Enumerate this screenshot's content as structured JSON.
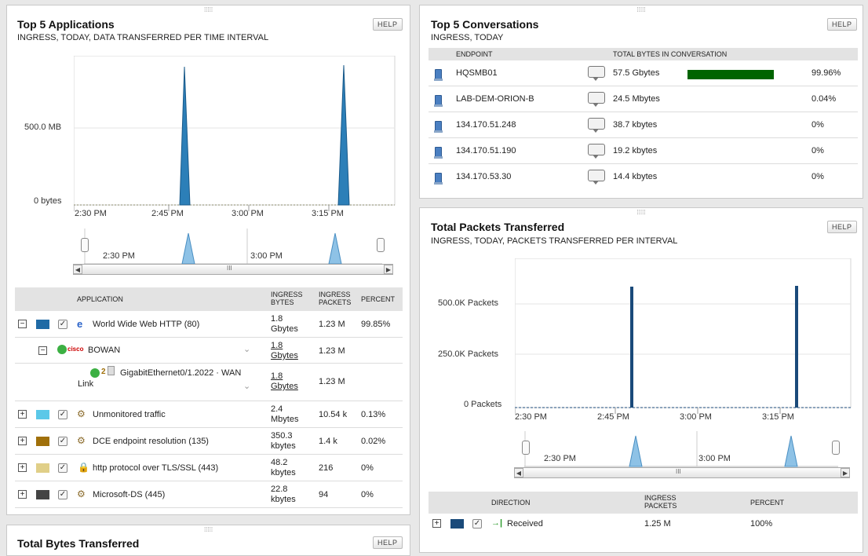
{
  "apps_panel": {
    "title": "Top 5 Applications",
    "subtitle": "INGRESS, TODAY, DATA TRANSFERRED PER TIME INTERVAL",
    "help": "HELP",
    "y_labels": [
      "500.0 MB",
      "0 bytes"
    ],
    "x_labels": [
      "2:30 PM",
      "2:45 PM",
      "3:00 PM",
      "3:15 PM"
    ],
    "nav_labels": [
      "2:30 PM",
      "3:00 PM"
    ],
    "scroll_grip": "III",
    "columns": {
      "application": "APPLICATION",
      "ingress_bytes": "INGRESS BYTES",
      "ingress_packets": "INGRESS PACKETS",
      "percent": "PERCENT"
    },
    "rows": [
      {
        "expander": "−",
        "color": "#1f6aa5",
        "name": "World Wide Web HTTP (80)",
        "bytes": "1.8 Gbytes",
        "packets": "1.23 M",
        "percent": "99.85%"
      },
      {
        "expander": "−",
        "name": "BOWAN",
        "bytes": "1.8 Gbytes",
        "packets": "1.23 M",
        "percent": ""
      },
      {
        "name": "GigabitEthernet0/1.2022 · WAN Link",
        "bytes": "1.8 Gbytes",
        "packets": "1.23 M",
        "percent": ""
      },
      {
        "expander": "+",
        "color": "#5bc8e8",
        "name": "Unmonitored traffic",
        "bytes": "2.4 Mbytes",
        "packets": "10.54 k",
        "percent": "0.13%"
      },
      {
        "expander": "+",
        "color": "#a0700a",
        "name": "DCE endpoint resolution (135)",
        "bytes": "350.3 kbytes",
        "packets": "1.4 k",
        "percent": "0.02%"
      },
      {
        "expander": "+",
        "color": "#e0cf88",
        "name": "http protocol over TLS/SSL (443)",
        "bytes": "48.2 kbytes",
        "packets": "216",
        "percent": "0%"
      },
      {
        "expander": "+",
        "color": "#444444",
        "name": "Microsoft-DS (445)",
        "bytes": "22.8 kbytes",
        "packets": "94",
        "percent": "0%"
      }
    ],
    "cisco_text": "cisco",
    "if_number": "2"
  },
  "bytes_panel": {
    "title": "Total Bytes Transferred",
    "help": "HELP"
  },
  "conv_panel": {
    "title": "Top 5 Conversations",
    "subtitle": "INGRESS, TODAY",
    "help": "HELP",
    "columns": {
      "endpoint": "ENDPOINT",
      "total": "TOTAL BYTES IN CONVERSATION"
    },
    "rows": [
      {
        "endpoint": "HQSMB01",
        "bytes": "57.5 Gbytes",
        "percent": "99.96%",
        "fill": 0.9996
      },
      {
        "endpoint": "LAB-DEM-ORION-B",
        "bytes": "24.5 Mbytes",
        "percent": "0.04%",
        "fill": 0.0004
      },
      {
        "endpoint": "134.170.51.248",
        "bytes": "38.7 kbytes",
        "percent": "0%",
        "fill": 0
      },
      {
        "endpoint": "134.170.51.190",
        "bytes": "19.2 kbytes",
        "percent": "0%",
        "fill": 0
      },
      {
        "endpoint": "134.170.53.30",
        "bytes": "14.4 kbytes",
        "percent": "0%",
        "fill": 0
      }
    ],
    "bar_color": "#006400"
  },
  "packets_panel": {
    "title": "Total Packets Transferred",
    "subtitle": "INGRESS, TODAY, PACKETS TRANSFERRED PER INTERVAL",
    "help": "HELP",
    "y_labels": [
      "500.0K Packets",
      "250.0K Packets",
      "0 Packets"
    ],
    "x_labels": [
      "2:30 PM",
      "2:45 PM",
      "3:00 PM",
      "3:15 PM"
    ],
    "nav_labels": [
      "2:30 PM",
      "3:00 PM"
    ],
    "scroll_grip": "III",
    "columns": {
      "direction": "DIRECTION",
      "ingress_packets": "INGRESS PACKETS",
      "percent": "PERCENT"
    },
    "rows": [
      {
        "expander": "+",
        "color": "#1a4a7a",
        "direction": "Received",
        "packets": "1.25 M",
        "percent": "100%"
      }
    ]
  },
  "colors": {
    "accent_blue": "#1f6aa5",
    "dark_blue": "#1a4a7a",
    "green_bar": "#006400"
  }
}
